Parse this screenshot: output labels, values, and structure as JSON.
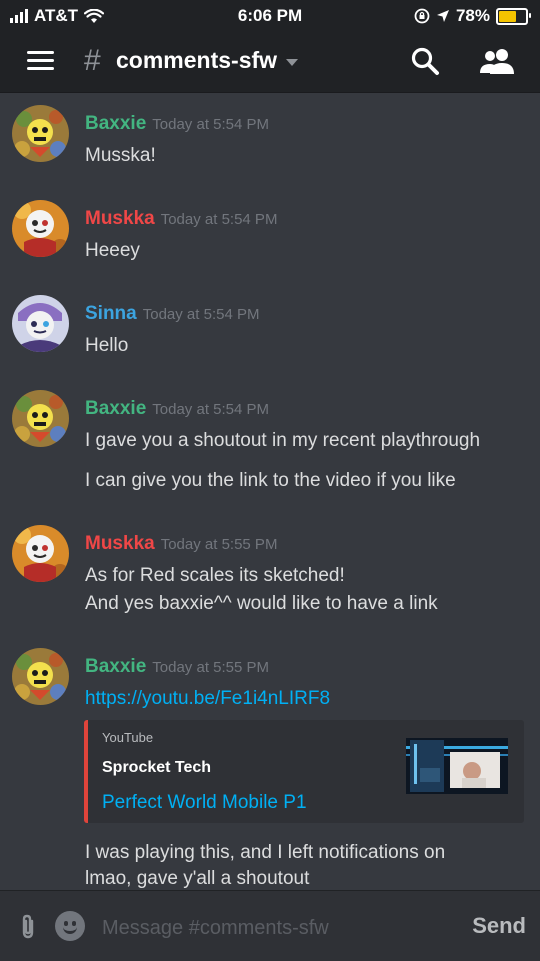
{
  "status_bar": {
    "carrier": "AT&T",
    "time": "6:06 PM",
    "battery_percent": "78%",
    "battery_level": 0.78,
    "icons": [
      "signal-icon",
      "wifi-icon",
      "orientation-lock-icon",
      "location-icon",
      "battery-icon"
    ]
  },
  "header": {
    "hash": "#",
    "channel": "comments-sfw",
    "icons": [
      "menu-icon",
      "chevron-down-icon",
      "search-icon",
      "members-icon"
    ]
  },
  "messages": [
    {
      "author": "Baxxie",
      "author_color": "#43b581",
      "timestamp": "Today at 5:54 PM",
      "lines": [
        "Musska!"
      ]
    },
    {
      "author": "Muskka",
      "author_color": "#f04747",
      "timestamp": "Today at 5:54 PM",
      "lines": [
        "Heeey"
      ]
    },
    {
      "author": "Sinna",
      "author_color": "#3ca4e0",
      "timestamp": "Today at 5:54 PM",
      "lines": [
        "Hello"
      ]
    },
    {
      "author": "Baxxie",
      "author_color": "#43b581",
      "timestamp": "Today at 5:54 PM",
      "lines": [
        "I gave you a shoutout in my recent playthrough",
        "I can give you the link to the video if you like"
      ]
    },
    {
      "author": "Muskka",
      "author_color": "#f04747",
      "timestamp": "Today at 5:55 PM",
      "lines": [
        "As for Red scales its sketched!",
        "And yes baxxie^^ would like to have a link"
      ]
    },
    {
      "author": "Baxxie",
      "author_color": "#43b581",
      "timestamp": "Today at 5:55 PM",
      "link": "https://youtu.be/Fe1i4nLIRF8",
      "lines": [
        "I was playing this, and I left notifications on",
        "lmao, gave y'all a shoutout"
      ]
    }
  ],
  "embed": {
    "provider": "YouTube",
    "author": "Sprocket Tech",
    "title": "Perfect World Mobile P1",
    "accent_color": "#e0443b"
  },
  "composer": {
    "placeholder": "Message #comments-sfw",
    "send_label": "Send",
    "icons": [
      "attachment-icon",
      "emoji-icon"
    ]
  },
  "colors": {
    "background": "#36393f",
    "header": "#202225",
    "link": "#00b0f4"
  }
}
